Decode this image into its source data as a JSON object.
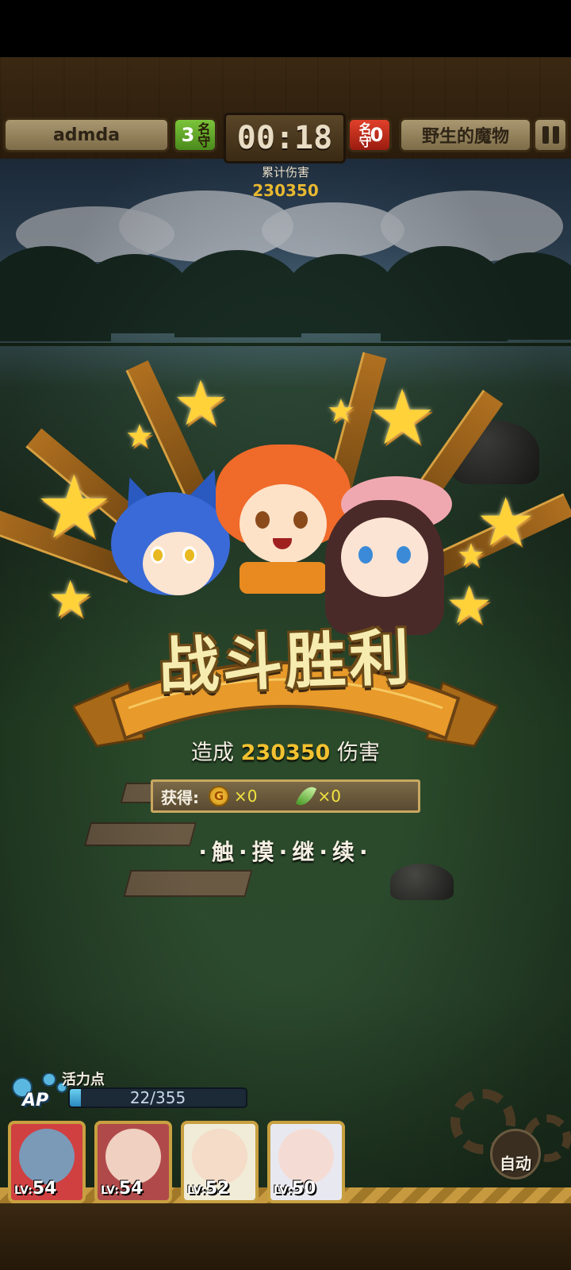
{
  "header": {
    "player_name": "admda",
    "player_count": "3",
    "player_count_unit": "名守",
    "timer": "00:18",
    "enemy_count": "0",
    "enemy_count_unit": "名守",
    "enemy_name": "野生的魔物",
    "damage_label": "累计伤害",
    "damage_total": "230350"
  },
  "result": {
    "title": "战斗胜利",
    "damage_prefix": "造成",
    "damage_value": "230350",
    "damage_suffix": "伤害",
    "reward_label": "获得:",
    "gold_icon": "gold-coin-icon",
    "gold_icon_letter": "G",
    "gold_amount": "×0",
    "leaf_icon": "leaf-icon",
    "leaf_amount": "×0",
    "continue_text": "·触·摸·继·续·"
  },
  "hud": {
    "ap_label": "活力点",
    "ap_badge": "AP",
    "ap_value": "22/355",
    "ap_fraction": 0.062,
    "auto_label": "自动",
    "team": [
      {
        "level_prefix": "LV:",
        "level": "54",
        "hair": "#d04040",
        "skin": "#7a9ab8"
      },
      {
        "level_prefix": "LV:",
        "level": "54",
        "hair": "#b04a4a",
        "skin": "#f0d0c0"
      },
      {
        "level_prefix": "LV:",
        "level": "52",
        "hair": "#f0ecd8",
        "skin": "#f4dcc8"
      },
      {
        "level_prefix": "LV:",
        "level": "50",
        "hair": "#e8e8f0",
        "skin": "#f4dcd4"
      }
    ]
  },
  "colors": {
    "accent_gold": "#f2c230",
    "wood": "#3a2812",
    "player_green": "#7bc43a",
    "enemy_red": "#e0402a"
  }
}
